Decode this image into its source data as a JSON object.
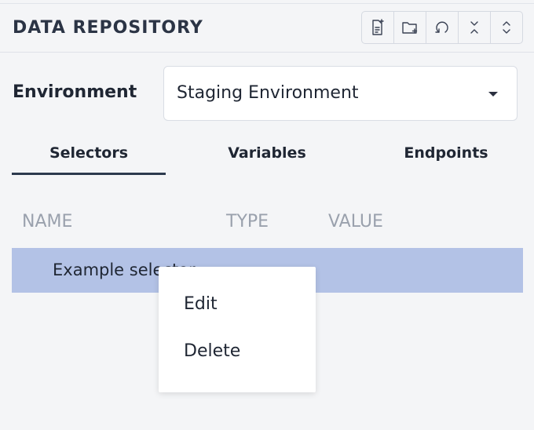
{
  "header": {
    "title": "DATA REPOSITORY",
    "toolbar": [
      {
        "icon": "new-file-icon"
      },
      {
        "icon": "new-folder-icon"
      },
      {
        "icon": "refresh-icon"
      },
      {
        "icon": "collapse-all-icon"
      },
      {
        "icon": "expand-all-icon"
      }
    ]
  },
  "environment": {
    "label": "Environment",
    "selected": "Staging Environment"
  },
  "tabs": [
    {
      "label": "Selectors",
      "active": true
    },
    {
      "label": "Variables",
      "active": false
    },
    {
      "label": "Endpoints",
      "active": false
    }
  ],
  "table": {
    "columns": [
      "NAME",
      "TYPE",
      "VALUE"
    ],
    "rows": [
      {
        "name": "Example selector",
        "type": "",
        "value": "",
        "selected": true
      }
    ]
  },
  "context_menu": {
    "items": [
      "Edit",
      "Delete"
    ]
  },
  "colors": {
    "selected_row": "#b3c2e6",
    "tab_underline": "#2d3a4e"
  }
}
